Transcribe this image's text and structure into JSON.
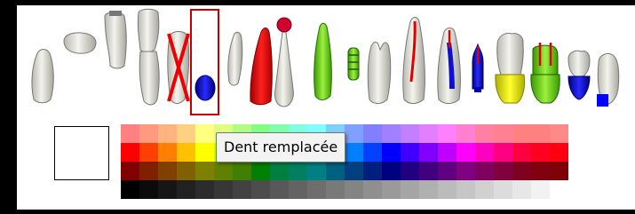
{
  "tooltip": {
    "text": "Dent remplacée"
  },
  "tools": [
    {
      "name": "tooth-root-tool",
      "icon": "tooth-root-icon"
    },
    {
      "name": "tooth-crown-tool",
      "icon": "tooth-crown-icon"
    },
    {
      "name": "tooth-extraction-tool",
      "icon": "tooth-extraction-icon"
    },
    {
      "name": "tooth-implant-tool",
      "icon": "tooth-implant-icon"
    },
    {
      "name": "tooth-extracted-tool",
      "icon": "tooth-extracted-icon"
    },
    {
      "name": "tooth-replaced-tool",
      "icon": "tooth-replaced-icon",
      "selected": true
    },
    {
      "name": "tooth-fragment-tool",
      "icon": "tooth-fragment-icon"
    },
    {
      "name": "red-crown-tool",
      "icon": "red-crown-icon"
    },
    {
      "name": "pin-tooth-tool",
      "icon": "pin-tooth-icon"
    },
    {
      "name": "green-crown-tool",
      "icon": "green-crown-icon"
    },
    {
      "name": "orthodontic-tool",
      "icon": "orthodontic-icon"
    },
    {
      "name": "molar-tool",
      "icon": "molar-icon"
    },
    {
      "name": "root-canal-red-tool",
      "icon": "root-canal-red-icon"
    },
    {
      "name": "root-canal-blue-tool",
      "icon": "root-canal-blue-icon"
    },
    {
      "name": "post-tool",
      "icon": "post-icon"
    },
    {
      "name": "yellow-molar-tool",
      "icon": "yellow-molar-icon"
    },
    {
      "name": "green-molar-tool",
      "icon": "green-molar-icon"
    },
    {
      "name": "blue-crown-tool",
      "icon": "blue-crown-icon"
    },
    {
      "name": "blue-corner-tooth-tool",
      "icon": "blue-corner-tooth-icon"
    }
  ],
  "palette": [
    [
      "#ff8080",
      "#ff9a80",
      "#ffb380",
      "#ffd080",
      "#ffff80",
      "#e0ff80",
      "#b0ff80",
      "#80ff80",
      "#80ffb0",
      "#80ffe0",
      "#80ffff",
      "#80d0ff",
      "#80a0ff",
      "#8080ff",
      "#a080ff",
      "#c080ff",
      "#e080ff",
      "#ff80ff",
      "#ff80d0",
      "#ff80a0",
      "#ff8090",
      "#ff8080",
      "#ff8080",
      "#ff8888"
    ],
    [
      "#ff0000",
      "#ff4000",
      "#ff8000",
      "#ffc000",
      "#ffff00",
      "#c0ff00",
      "#80ff00",
      "#00ff00",
      "#00ff80",
      "#00ffc0",
      "#00ffff",
      "#00c0ff",
      "#0080ff",
      "#0040ff",
      "#0000ff",
      "#4000ff",
      "#8000ff",
      "#c000ff",
      "#ff00ff",
      "#ff00c0",
      "#ff0080",
      "#ff0040",
      "#ff0020",
      "#ff0010"
    ],
    [
      "#800000",
      "#802000",
      "#804000",
      "#806000",
      "#808000",
      "#608000",
      "#408000",
      "#008000",
      "#008040",
      "#008060",
      "#008080",
      "#006080",
      "#004080",
      "#002080",
      "#000080",
      "#200080",
      "#400080",
      "#600080",
      "#800080",
      "#800060",
      "#800040",
      "#800020",
      "#800010",
      "#800008"
    ],
    [
      "#000000",
      "#0b0b0b",
      "#161616",
      "#212121",
      "#2c2c2c",
      "#373737",
      "#424242",
      "#4d4d4d",
      "#585858",
      "#636363",
      "#6e6e6e",
      "#797979",
      "#848484",
      "#8f8f8f",
      "#9a9a9a",
      "#a5a5a5",
      "#b0b0b0",
      "#bbbbbb",
      "#c6c6c6",
      "#d1d1d1",
      "#dcdcdc",
      "#e7e7e7",
      "#f2f2f2",
      "#ffffff"
    ]
  ],
  "preview_color": "#ffffff"
}
